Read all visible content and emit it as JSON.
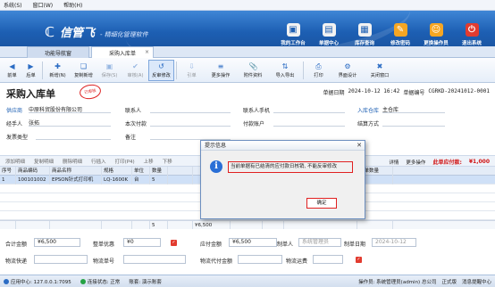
{
  "menu": [
    "系统(S)",
    "窗口(W)",
    "帮助(H)"
  ],
  "banner": {
    "logo_mark": "ℂ",
    "app_name": "信管飞",
    "slogan": "- 精细化管理软件",
    "buttons": [
      {
        "label": "我的工作台",
        "icon": "desk-icon",
        "color": "#f2f2f2",
        "glyph": "▣"
      },
      {
        "label": "单据中心",
        "icon": "documents-icon",
        "color": "#f2f2f2",
        "glyph": "▤"
      },
      {
        "label": "库存查询",
        "icon": "inventory-icon",
        "color": "#f2f2f2",
        "glyph": "▦"
      },
      {
        "label": "修改密码",
        "icon": "password-icon",
        "color": "#f5a623",
        "glyph": "✎"
      },
      {
        "label": "更换操作员",
        "icon": "user-switch-icon",
        "color": "#f5a623",
        "glyph": "☺"
      },
      {
        "label": "退出系统",
        "icon": "power-icon",
        "color": "#e23b2f",
        "glyph": "⏻"
      }
    ]
  },
  "tabs": [
    {
      "label": "功能导航窗",
      "active": false
    },
    {
      "label": "采购入库单",
      "active": true
    }
  ],
  "toolbar": [
    {
      "label": "前单",
      "glyph": "◀",
      "kind": "",
      "enabled": true
    },
    {
      "label": "后单",
      "glyph": "▶",
      "kind": "",
      "enabled": true
    },
    {
      "label": "新增(N)",
      "glyph": "✚",
      "kind": "w",
      "enabled": true
    },
    {
      "label": "复制新增",
      "glyph": "❏",
      "kind": "w",
      "enabled": true
    },
    {
      "label": "保存(S)",
      "glyph": "▣",
      "kind": "w",
      "enabled": false
    },
    {
      "label": "审核(A)",
      "glyph": "✔",
      "kind": "w",
      "enabled": false
    },
    {
      "label": "反审修改",
      "glyph": "↺",
      "kind": "w sel",
      "enabled": true
    },
    {
      "label": "引单",
      "glyph": "⇩",
      "kind": "w",
      "enabled": false
    },
    {
      "label": "更多操作",
      "glyph": "≡",
      "kind": "ww",
      "enabled": true
    },
    {
      "label": "附件资料",
      "glyph": "📎",
      "kind": "ww",
      "enabled": true
    },
    {
      "label": "导入导出",
      "glyph": "⇅",
      "kind": "ww",
      "enabled": true
    },
    {
      "label": "打印",
      "glyph": "⎙",
      "kind": "w",
      "enabled": true
    },
    {
      "label": "界面设计",
      "glyph": "⚙",
      "kind": "ww",
      "enabled": true
    },
    {
      "label": "关闭窗口",
      "glyph": "✖",
      "kind": "ww",
      "enabled": true
    }
  ],
  "form": {
    "title": "采购入库单",
    "stamp": "已审核",
    "date_label": "单据日期",
    "date_value": "2024-10-12 16:42",
    "no_label": "单据编号",
    "no_value": "CGRKD-20241012-0001",
    "supplier_label": "供应商",
    "supplier_value": "中原科贸股份有限公司",
    "handler_label": "经手人",
    "handler_value": "张拓",
    "invoice_label": "发票类型",
    "contact_label": "联系人",
    "pay_label": "本次付款",
    "remark_label": "备注",
    "phone_label": "联系人手机",
    "account_label": "付款账户",
    "warehouse_label": "入库仓库",
    "warehouse_value": "主仓库",
    "settle_label": "结算方式"
  },
  "gridbar": {
    "buttons": [
      "添加明细",
      "复制明细",
      "删除明细",
      "行插入",
      "打印(P4)",
      "上移",
      "下移"
    ],
    "detail_link": "详情",
    "more": "更多操作",
    "due_label": "此单应付款:",
    "due_value": "¥1,000"
  },
  "grid": {
    "headers": [
      "序号",
      "商品编码",
      "商品名称",
      "规格",
      "单位",
      "数量",
      "",
      "",
      "",
      "",
      "引单信息",
      "引单数量"
    ],
    "rows": [
      [
        "1",
        "100101002",
        "EPSON针式打印机",
        "LQ-1600K",
        "台",
        "5",
        "",
        "",
        "",
        "",
        "采购订单CGDD-20240930-0003",
        "5"
      ]
    ],
    "totals": [
      "",
      "",
      "",
      "",
      "",
      "5",
      "",
      "¥6,500",
      "",
      "",
      "",
      ""
    ]
  },
  "bottom": {
    "total_label": "合计金额",
    "total_value": "¥6,500",
    "discount_label": "整单优惠",
    "discount_value": "¥0",
    "payable_label": "应付金额",
    "payable_value": "¥6,500",
    "maker_label": "制单人",
    "maker_value": "系统管理员",
    "make_date_label": "制单日期",
    "make_date_value": "2024-10-12",
    "express_label": "物流快递",
    "track_label": "物流单号",
    "fee_label": "物流代付金额",
    "cod_label": "物流运费"
  },
  "status": {
    "app_center": "应用中心: 127.0.0.1:7095",
    "connection": "连接状态: 正常",
    "account": "账套: 演示账套",
    "operator": "操作员: 系统管理员(admin) 总公司",
    "edition": "正式版",
    "notice": "消息提醒中心"
  },
  "dialog": {
    "title": "提示信息",
    "message": "当前单据有已结清的应付款日核销, 不能反审修改",
    "ok": "确定"
  }
}
